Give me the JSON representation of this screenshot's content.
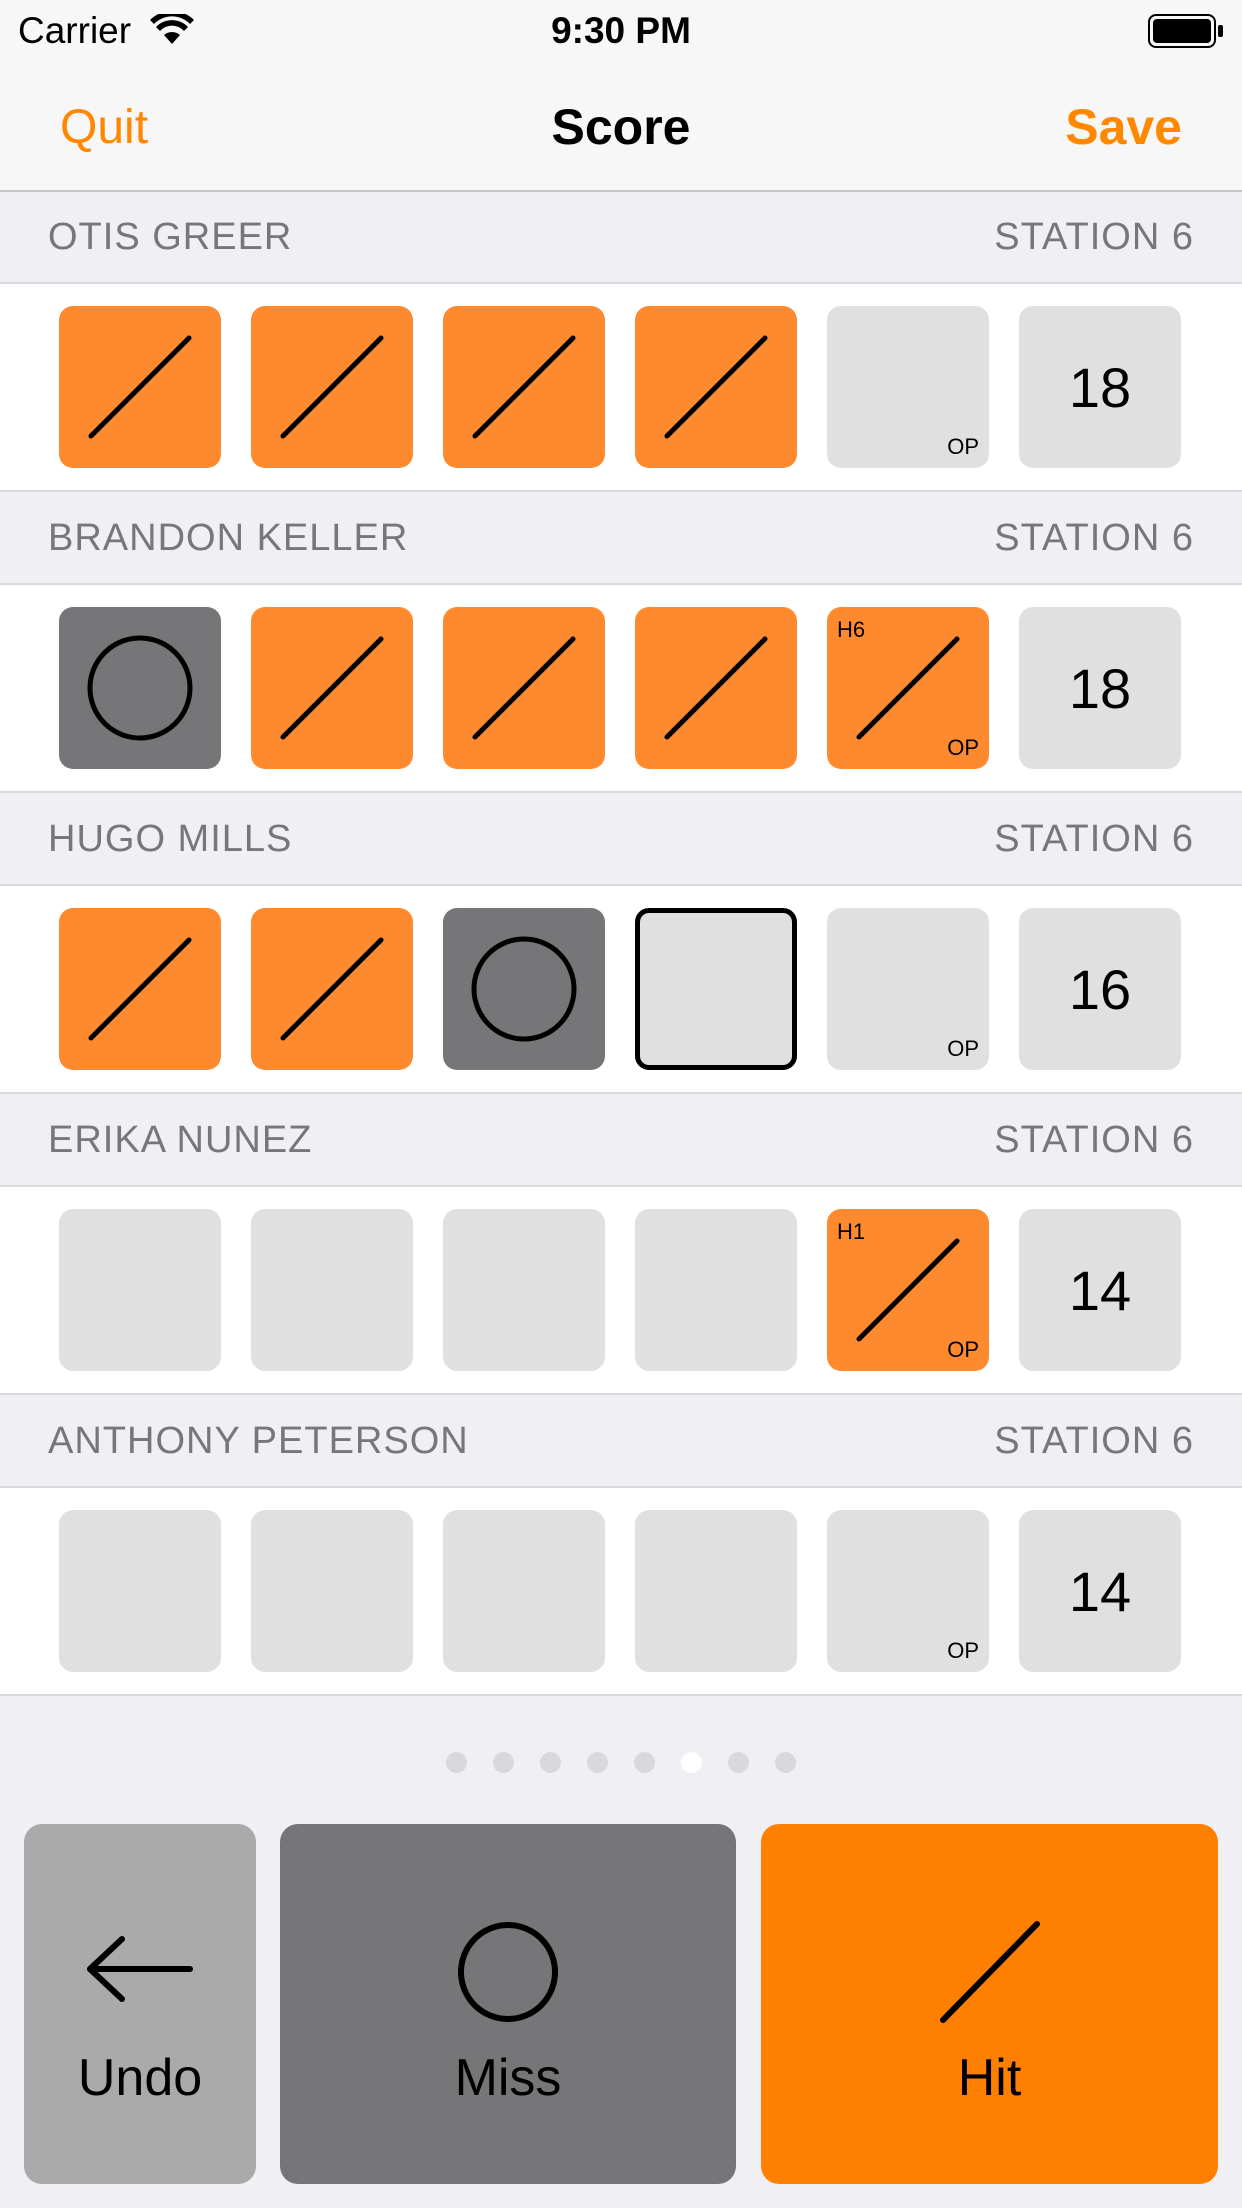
{
  "status_bar": {
    "carrier": "Carrier",
    "time": "9:30 PM"
  },
  "nav": {
    "quit_label": "Quit",
    "title": "Score",
    "save_label": "Save"
  },
  "players": [
    {
      "name": "OTIS GREER",
      "station": "STATION 6",
      "score": "18",
      "shots": [
        {
          "state": "hit",
          "op": false,
          "tag": ""
        },
        {
          "state": "hit",
          "op": false,
          "tag": ""
        },
        {
          "state": "hit",
          "op": false,
          "tag": ""
        },
        {
          "state": "hit",
          "op": false,
          "tag": ""
        },
        {
          "state": "empty",
          "op": true,
          "tag": ""
        }
      ]
    },
    {
      "name": "BRANDON KELLER",
      "station": "STATION 6",
      "score": "18",
      "shots": [
        {
          "state": "miss",
          "op": false,
          "tag": ""
        },
        {
          "state": "hit",
          "op": false,
          "tag": ""
        },
        {
          "state": "hit",
          "op": false,
          "tag": ""
        },
        {
          "state": "hit",
          "op": false,
          "tag": ""
        },
        {
          "state": "hit",
          "op": true,
          "tag": "H6"
        }
      ]
    },
    {
      "name": "HUGO MILLS",
      "station": "STATION 6",
      "score": "16",
      "shots": [
        {
          "state": "hit",
          "op": false,
          "tag": ""
        },
        {
          "state": "hit",
          "op": false,
          "tag": ""
        },
        {
          "state": "miss",
          "op": false,
          "tag": ""
        },
        {
          "state": "selected",
          "op": false,
          "tag": ""
        },
        {
          "state": "empty",
          "op": true,
          "tag": ""
        }
      ]
    },
    {
      "name": "ERIKA NUNEZ",
      "station": "STATION 6",
      "score": "14",
      "shots": [
        {
          "state": "empty",
          "op": false,
          "tag": ""
        },
        {
          "state": "empty",
          "op": false,
          "tag": ""
        },
        {
          "state": "empty",
          "op": false,
          "tag": ""
        },
        {
          "state": "empty",
          "op": false,
          "tag": ""
        },
        {
          "state": "hit",
          "op": true,
          "tag": "H1"
        }
      ]
    },
    {
      "name": "ANTHONY PETERSON",
      "station": "STATION 6",
      "score": "14",
      "shots": [
        {
          "state": "empty",
          "op": false,
          "tag": ""
        },
        {
          "state": "empty",
          "op": false,
          "tag": ""
        },
        {
          "state": "empty",
          "op": false,
          "tag": ""
        },
        {
          "state": "empty",
          "op": false,
          "tag": ""
        },
        {
          "state": "empty",
          "op": true,
          "tag": ""
        }
      ]
    }
  ],
  "op_label": "OP",
  "pager": {
    "count": 8,
    "active_index": 5
  },
  "actions": {
    "undo_label": "Undo",
    "miss_label": "Miss",
    "hit_label": "Hit"
  },
  "colors": {
    "accent": "#ff8800",
    "hit": "#fd8a2f",
    "miss": "#767577",
    "empty": "#e0e0e0"
  },
  "icons": {
    "undo": "arrow-left-icon",
    "miss": "circle-icon",
    "hit": "slash-icon"
  }
}
